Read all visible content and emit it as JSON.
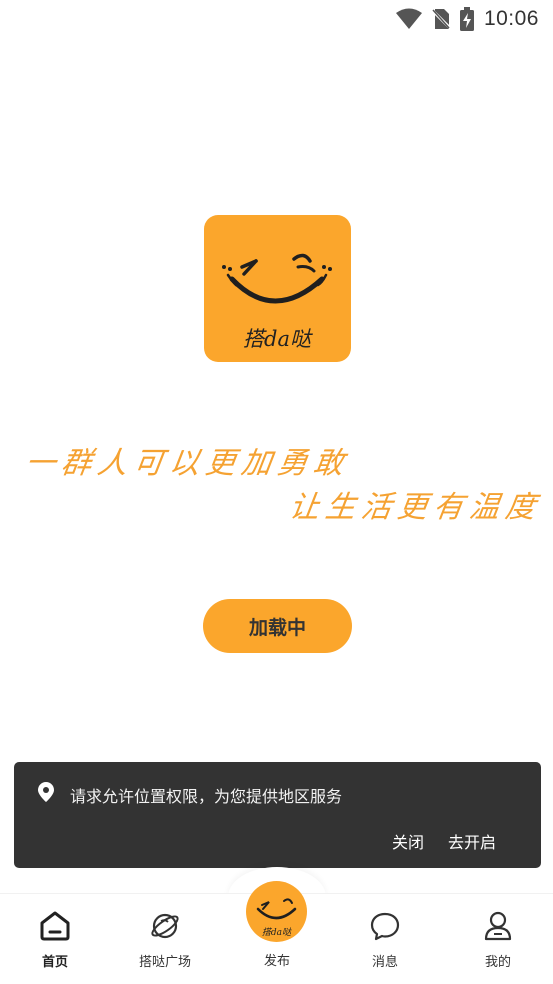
{
  "status_bar": {
    "time": "10:06"
  },
  "logo": {
    "alt_text": "搭da哒"
  },
  "slogans": {
    "line1": "一群人可以更加勇敢",
    "line2": "让生活更有温度"
  },
  "loading": {
    "label": "加载中"
  },
  "permission_prompt": {
    "message": "请求允许位置权限，为您提供地区服务",
    "close_label": "关闭",
    "open_label": "去开启"
  },
  "tabbar": {
    "home": "首页",
    "square": "搭哒广场",
    "publish": "发布",
    "messages": "消息",
    "mine": "我的"
  },
  "colors": {
    "brand": "#FBA62C",
    "snackbar": "#333333"
  },
  "icons": [
    "wifi-icon",
    "no-sim-icon",
    "battery-charging-icon",
    "location-pin-icon",
    "home-icon",
    "planet-icon",
    "chat-bubble-icon",
    "person-icon"
  ]
}
